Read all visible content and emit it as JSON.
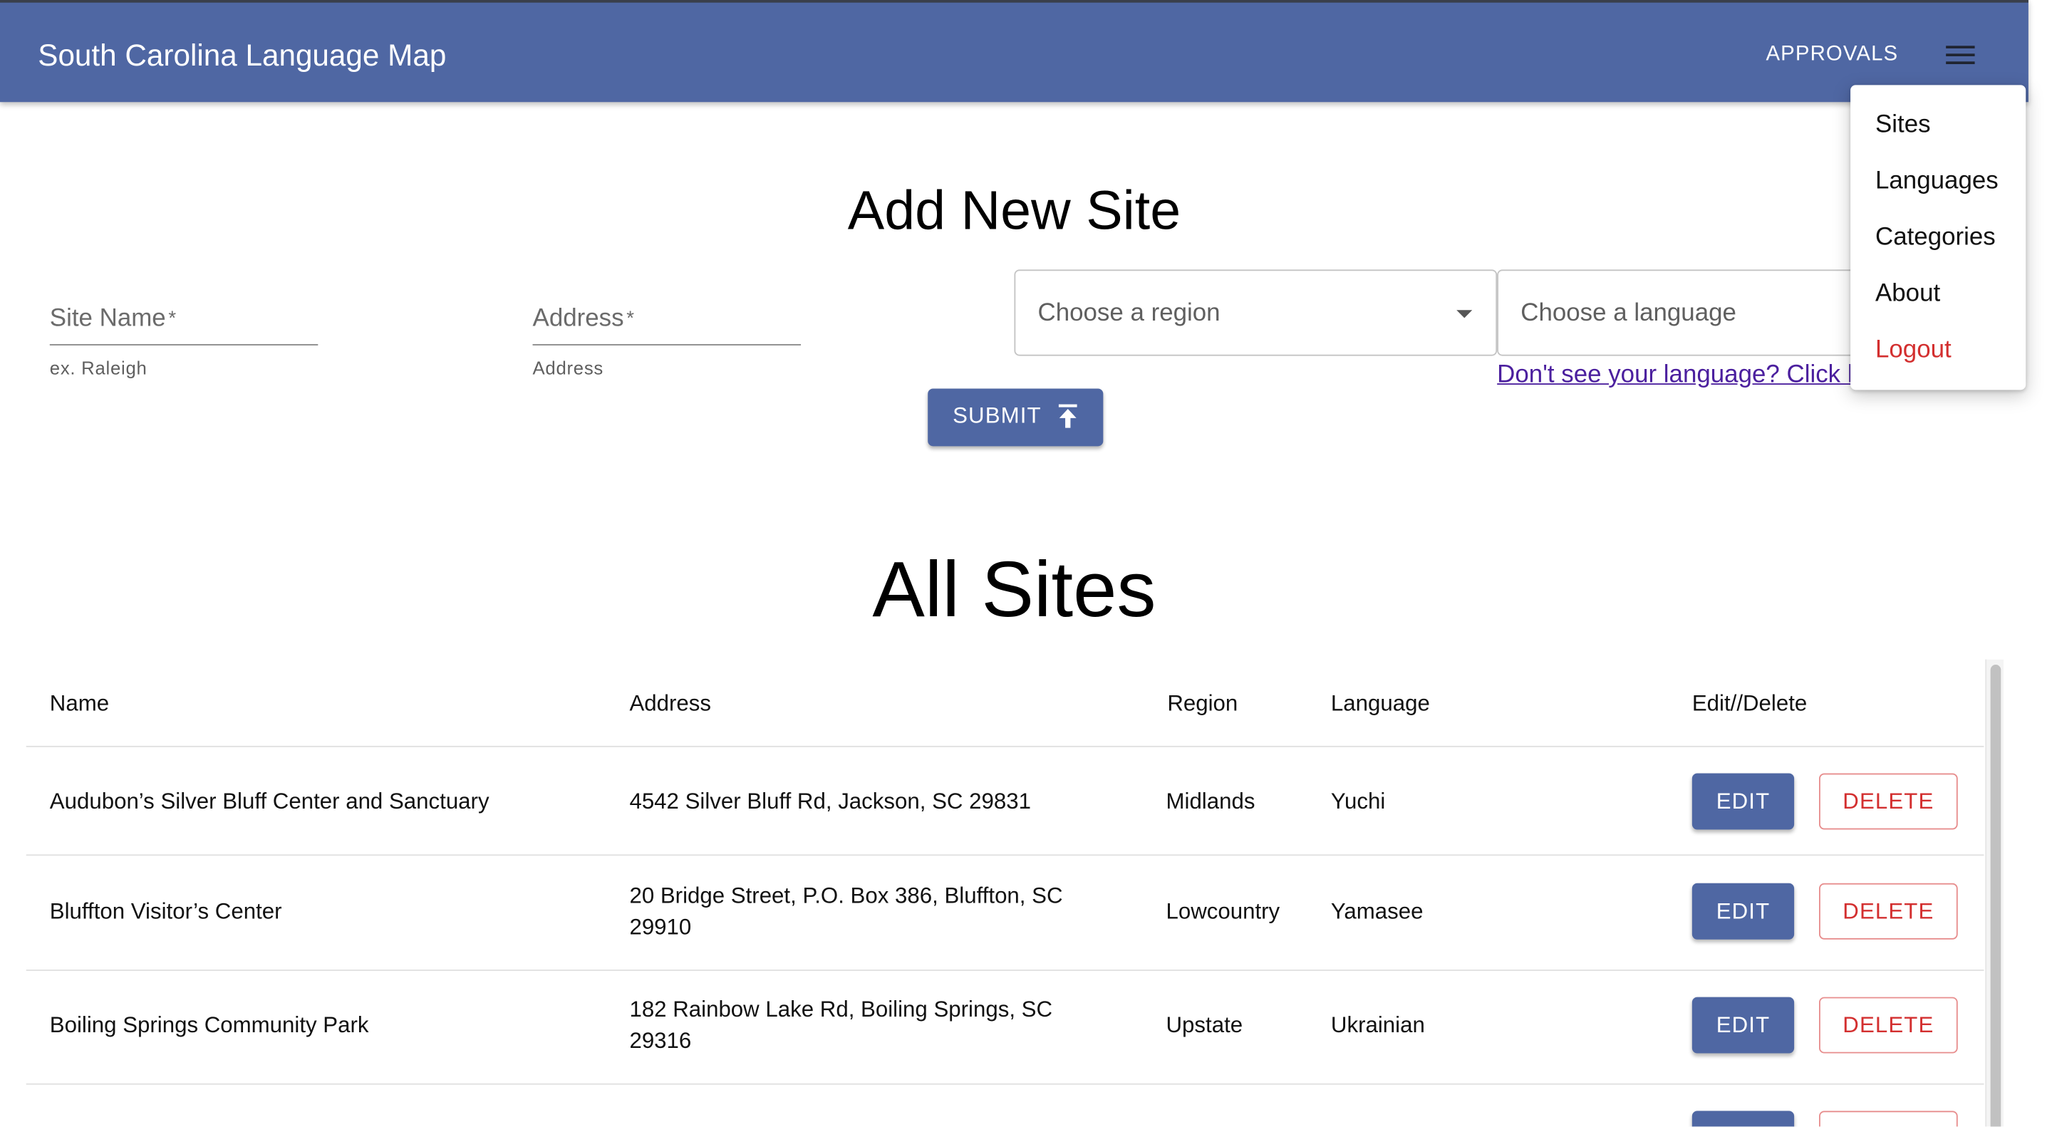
{
  "header": {
    "title": "South Carolina Language Map",
    "approvals_label": "APPROVALS",
    "menu_icon": "hamburger-menu-icon",
    "bar_color": "#4f67a3"
  },
  "menu": {
    "items": [
      {
        "label": "Sites"
      },
      {
        "label": "Languages"
      },
      {
        "label": "Categories"
      },
      {
        "label": "About"
      },
      {
        "label": "Logout"
      }
    ],
    "logout_color": "#d32f2f"
  },
  "add_site": {
    "title": "Add New Site",
    "site_name": {
      "label": "Site Name",
      "required_mark": "*",
      "helper": "ex. Raleigh"
    },
    "address": {
      "label": "Address",
      "required_mark": "*",
      "helper": "Address"
    },
    "region_select": {
      "placeholder": "Choose a region",
      "icon": "dropdown-arrow-icon"
    },
    "language_select": {
      "placeholder": "Choose a language"
    },
    "missing_language_link": "Don't see your language? Click here",
    "submit_label": "SUBMIT",
    "submit_icon": "upload-icon"
  },
  "sites": {
    "title": "All Sites",
    "columns": [
      "Name",
      "Address",
      "Region",
      "Language",
      "Edit//Delete"
    ],
    "rows": [
      {
        "name": "Audubon’s Silver Bluff Center and Sanctuary",
        "address": "4542 Silver Bluff Rd, Jackson, SC 29831",
        "region": "Midlands",
        "language": "Yuchi"
      },
      {
        "name": "Bluffton Visitor’s Center",
        "address": "20 Bridge Street, P.O. Box 386, Bluffton, SC 29910",
        "region": "Lowcountry",
        "language": "Yamasee"
      },
      {
        "name": "Boiling Springs Community Park",
        "address": "182 Rainbow Lake Rd, Boiling Springs, SC 29316",
        "region": "Upstate",
        "language": "Ukrainian"
      }
    ],
    "edit_label": "EDIT",
    "delete_label": "DELETE"
  }
}
